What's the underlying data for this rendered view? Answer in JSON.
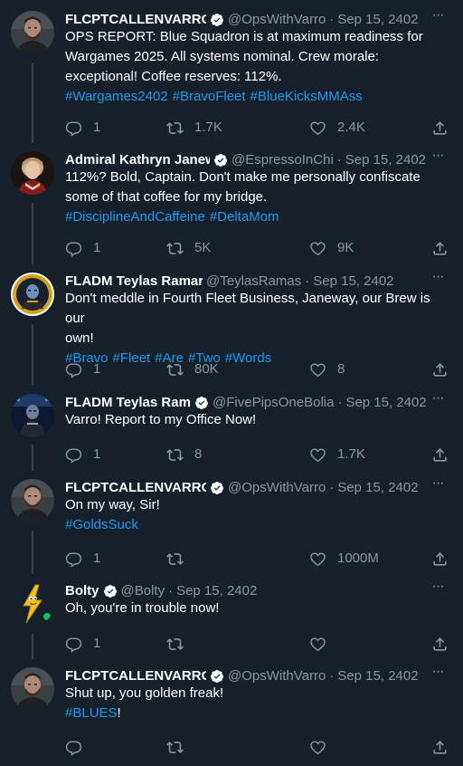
{
  "tweets": [
    {
      "name": "FLCPTCALLENVARRO",
      "verified": true,
      "handle": "@OpsWithVarro",
      "sep": "·",
      "date": "Sep 15, 2402",
      "lines": [
        "OPS REPORT: Blue Squadron is at maximum readiness for",
        "Wargames 2025. All systems nominal. Crew morale:",
        "exceptional! Coffee reserves: 112%."
      ],
      "hashtags": [
        "#Wargames2402",
        "#BravoFleet",
        "#BlueKicksMMAss"
      ],
      "tail": "",
      "replies": "1",
      "retweets": "1.7K",
      "likes": "2.4K",
      "avatar_icon": "bearded-man-avatar"
    },
    {
      "name": "Admiral Kathryn Janew",
      "verified": true,
      "handle": "@EspressoInChi",
      "sep": "·",
      "date": "Sep 15, 2402",
      "lines": [
        "112%? Bold, Captain. Don't make me personally confiscate",
        "some of that coffee for my bridge."
      ],
      "hashtags": [
        "#DisciplineAndCaffeine",
        "#DeltaMom"
      ],
      "tail": "",
      "replies": "1",
      "retweets": "5K",
      "likes": "9K",
      "avatar_icon": "admiral-woman-avatar"
    },
    {
      "name": "FLADM Teylas Ramar",
      "verified": false,
      "handle": "@TeylasRamas",
      "sep": "·",
      "date": "Sep 15, 2402",
      "lines": [
        "Don't meddle in Fourth Fleet Business, Janeway, our Brew is our",
        "own!"
      ],
      "hashtags": [
        "#Bravo",
        "#Fleet",
        "#Are",
        "#Two",
        "#Words"
      ],
      "tail": "",
      "replies": "1",
      "retweets": "80K",
      "likes": "8",
      "avatar_icon": "alien-admiral-avatar"
    },
    {
      "name": "FLADM Teylas Ramar",
      "verified": true,
      "handle": "@FivePipsOneBolia",
      "sep": "·",
      "date": "Sep 15, 2402",
      "lines": [
        "Varro! Report to my Office Now!"
      ],
      "hashtags": [],
      "tail": "",
      "replies": "1",
      "retweets": "8",
      "likes": "1.7K",
      "avatar_icon": "alien-admiral-bridge-avatar"
    },
    {
      "name": "FLCPTCALLENVARRO",
      "verified": true,
      "handle": "@OpsWithVarro",
      "sep": "·",
      "date": "Sep 15, 2402",
      "lines": [
        "On my way, Sir!"
      ],
      "hashtags": [
        "#GoldsSuck"
      ],
      "tail": "",
      "replies": "1",
      "retweets": "",
      "likes": "1000M",
      "avatar_icon": "bearded-man-avatar"
    },
    {
      "name": "Bolty",
      "verified": true,
      "handle": "@Bolty",
      "sep": "·",
      "date": "Sep 15, 2402",
      "lines": [
        "Oh, you're in trouble now!"
      ],
      "hashtags": [],
      "tail": "",
      "replies": "1",
      "retweets": "",
      "likes": "",
      "avatar_icon": "lightning-bolt-mascot-avatar"
    },
    {
      "name": "FLCPTCALLENVARRO",
      "verified": true,
      "handle": "@OpsWithVarro",
      "sep": "·",
      "date": "Sep 15, 2402",
      "lines": [
        "Shut up, you golden freak!"
      ],
      "hashtags": [
        "#BLUES"
      ],
      "tail": "!",
      "replies": "",
      "retweets": "",
      "likes": "",
      "avatar_icon": "bearded-man-avatar"
    }
  ],
  "more_label": "···",
  "colors": {
    "background": "#15202b",
    "text": "#ffffff",
    "muted": "#8899a6",
    "link": "#1d9bf0",
    "verified": "#ffffff",
    "thread_line": "#38444d"
  }
}
